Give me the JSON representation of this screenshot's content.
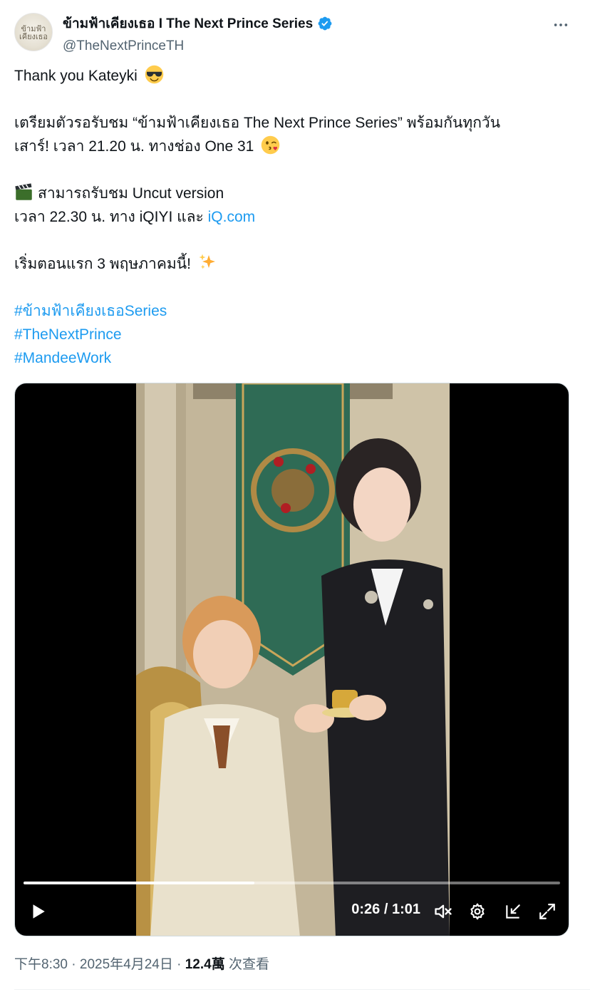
{
  "author": {
    "display_name": "ข้ามฟ้าเคียงเธอ I The Next Prince Series",
    "handle": "@TheNextPrinceTH",
    "avatar_text": "ข้ามฟ้า เคียงเธอ",
    "verified": true
  },
  "more_icon": "more-horizontal-icon",
  "tweet": {
    "line1": "Thank you Kateyki",
    "line2": "เตรียมตัวรอรับชม “ข้ามฟ้าเคียงเธอ The Next Prince Series” พร้อมกันทุกวัน",
    "line3": "เสาร์! เวลา 21.20 น. ทางช่อง One 31",
    "line4": "สามารถรับชม Uncut version",
    "line5_prefix": "เวลา 22.30 น. ทาง iQIYI และ ",
    "line5_link": "iQ.com",
    "line6": "เริ่มตอนแรก 3 พฤษภาคมนี้!",
    "hashtags": [
      "#ข้ามฟ้าเคียงเธอSeries",
      "#TheNextPrince",
      "#MandeeWork"
    ]
  },
  "video": {
    "current_time": "0:26",
    "separator": "/",
    "duration": "1:01",
    "progress": 0.43
  },
  "meta": {
    "time": "下午8:30",
    "dot1": " · ",
    "date": "2025年4月24日",
    "dot2": " · ",
    "views": "12.4萬",
    "views_label": " 次查看"
  },
  "colors": {
    "link": "#1d9bf0",
    "verified": "#1d9bf0",
    "text": "#0f1419",
    "secondary": "#536471"
  }
}
